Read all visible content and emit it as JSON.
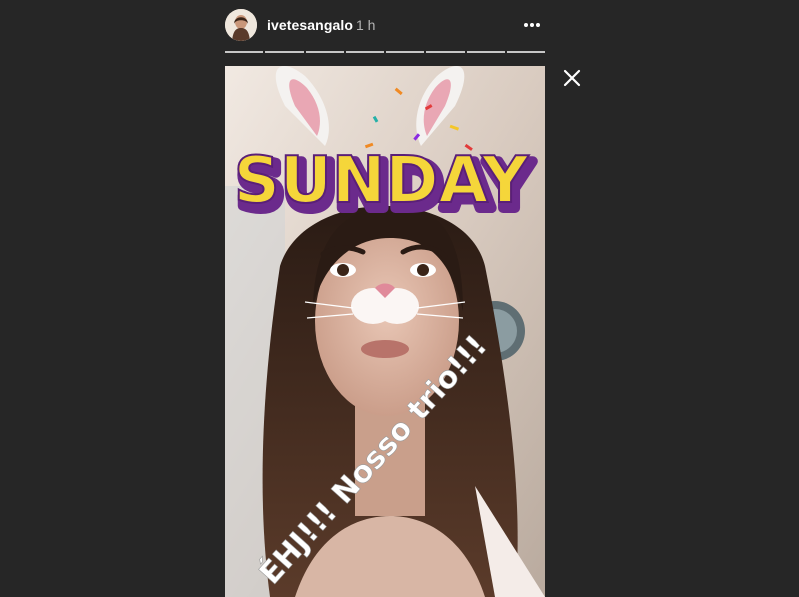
{
  "story": {
    "username": "ivetesangalo",
    "timestamp": "1 h",
    "segment_count": 8,
    "sticker_word": "SUNDAY",
    "caption": "ÉHJ!!! Nosso trio!!!"
  },
  "icons": {
    "more": "more-horizontal-icon",
    "close": "close-icon"
  },
  "colors": {
    "background": "#262626",
    "progress": "#c7c7c7",
    "sticker_fill": "#f5d63a",
    "sticker_outline": "#6b2a8c"
  }
}
